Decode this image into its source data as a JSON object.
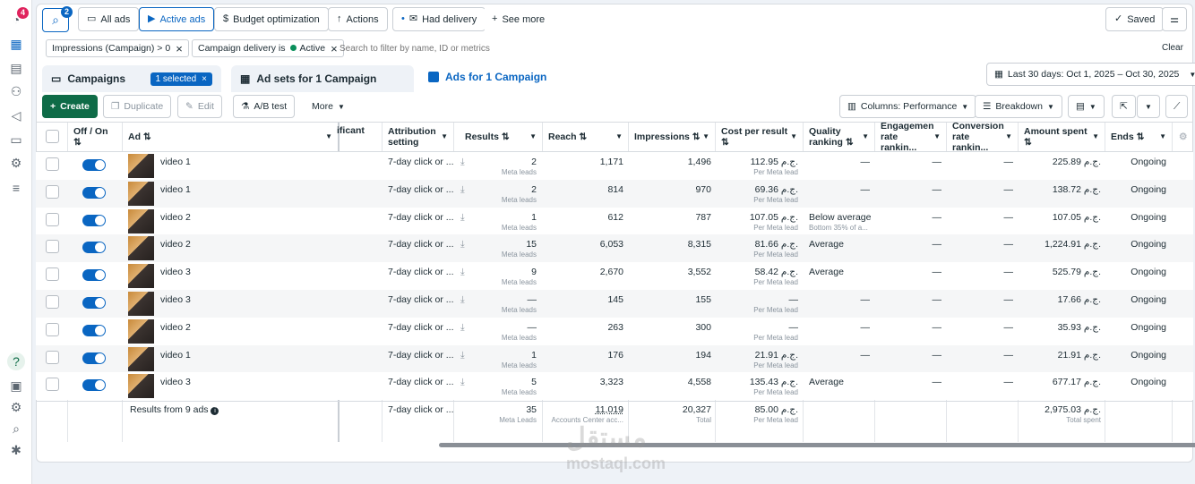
{
  "nav": {
    "notifications": "4",
    "search_badge": "2"
  },
  "filterbar": {
    "all_ads": "All ads",
    "active_ads": "Active ads",
    "budget_optimization": "Budget optimization",
    "actions": "Actions",
    "had_delivery": "Had delivery",
    "see_more": "See more",
    "saved": "Saved"
  },
  "filters": {
    "chip1": "Impressions (Campaign) > 0",
    "chip2_prefix": "Campaign delivery is",
    "chip2_value": "Active",
    "search_placeholder": "Search to filter by name, ID or metrics",
    "clear": "Clear"
  },
  "tabs": {
    "campaigns": "Campaigns",
    "selected": "1 selected",
    "adsets": "Ad sets for 1 Campaign",
    "ads": "Ads for 1 Campaign",
    "date_range": "Last 30 days: Oct 1, 2025 – Oct 30, 2025"
  },
  "toolbar": {
    "create": "Create",
    "duplicate": "Duplicate",
    "edit": "Edit",
    "ab_test": "A/B test",
    "more": "More",
    "columns": "Columns: Performance",
    "breakdown": "Breakdown"
  },
  "columns": {
    "onoff": "Off / On",
    "ad": "Ad",
    "significant": "ificant",
    "attribution": "Attribution setting",
    "results": "Results",
    "reach": "Reach",
    "impressions": "Impressions",
    "cpr": "Cost per result",
    "quality": "Quality ranking",
    "engagement": "Engagement rate rankin...",
    "conversion": "Conversion rate rankin...",
    "amount": "Amount spent",
    "ends": "Ends"
  },
  "rows": [
    {
      "ad": "video 1",
      "attr": "7-day click or ...",
      "results": "2",
      "results_sub": "Meta leads",
      "reach": "1,171",
      "impr": "1,496",
      "cpr": "112.95 ج.م.",
      "cpr_sub": "Per Meta lead",
      "quality": "—",
      "quality_sub": "",
      "eng": "—",
      "conv": "—",
      "amount": "225.89 ج.م.",
      "ends": "Ongoing"
    },
    {
      "ad": "video 1",
      "attr": "7-day click or ...",
      "results": "2",
      "results_sub": "Meta leads",
      "reach": "814",
      "impr": "970",
      "cpr": "69.36 ج.م.",
      "cpr_sub": "Per Meta lead",
      "quality": "—",
      "quality_sub": "",
      "eng": "—",
      "conv": "—",
      "amount": "138.72 ج.م.",
      "ends": "Ongoing"
    },
    {
      "ad": "video 2",
      "attr": "7-day click or ...",
      "results": "1",
      "results_sub": "Meta leads",
      "reach": "612",
      "impr": "787",
      "cpr": "107.05 ج.م.",
      "cpr_sub": "Per Meta lead",
      "quality": "Below average",
      "quality_sub": "Bottom 35% of a...",
      "eng": "—",
      "conv": "—",
      "amount": "107.05 ج.م.",
      "ends": "Ongoing"
    },
    {
      "ad": "video 2",
      "attr": "7-day click or ...",
      "results": "15",
      "results_sub": "Meta leads",
      "reach": "6,053",
      "impr": "8,315",
      "cpr": "81.66 ج.م.",
      "cpr_sub": "Per Meta lead",
      "quality": "Average",
      "quality_sub": "",
      "eng": "—",
      "conv": "—",
      "amount": "1,224.91 ج.م.",
      "ends": "Ongoing"
    },
    {
      "ad": "video 3",
      "attr": "7-day click or ...",
      "results": "9",
      "results_sub": "Meta leads",
      "reach": "2,670",
      "impr": "3,552",
      "cpr": "58.42 ج.م.",
      "cpr_sub": "Per Meta lead",
      "quality": "Average",
      "quality_sub": "",
      "eng": "—",
      "conv": "—",
      "amount": "525.79 ج.م.",
      "ends": "Ongoing"
    },
    {
      "ad": "video 3",
      "attr": "7-day click or ...",
      "results": "—",
      "results_sub": "Meta leads",
      "reach": "145",
      "impr": "155",
      "cpr": "—",
      "cpr_sub": "Per Meta lead",
      "quality": "—",
      "quality_sub": "",
      "eng": "—",
      "conv": "—",
      "amount": "17.66 ج.م.",
      "ends": "Ongoing"
    },
    {
      "ad": "video 2",
      "attr": "7-day click or ...",
      "results": "—",
      "results_sub": "Meta leads",
      "reach": "263",
      "impr": "300",
      "cpr": "—",
      "cpr_sub": "Per Meta lead",
      "quality": "—",
      "quality_sub": "",
      "eng": "—",
      "conv": "—",
      "amount": "35.93 ج.م.",
      "ends": "Ongoing"
    },
    {
      "ad": "video 1",
      "attr": "7-day click or ...",
      "results": "1",
      "results_sub": "Meta leads",
      "reach": "176",
      "impr": "194",
      "cpr": "21.91 ج.م.",
      "cpr_sub": "Per Meta lead",
      "quality": "—",
      "quality_sub": "",
      "eng": "—",
      "conv": "—",
      "amount": "21.91 ج.م.",
      "ends": "Ongoing"
    },
    {
      "ad": "video 3",
      "attr": "7-day click or ...",
      "results": "5",
      "results_sub": "Meta leads",
      "reach": "3,323",
      "impr": "4,558",
      "cpr": "135.43 ج.م.",
      "cpr_sub": "Per Meta lead",
      "quality": "Average",
      "quality_sub": "",
      "eng": "—",
      "conv": "—",
      "amount": "677.17 ج.م.",
      "ends": "Ongoing"
    }
  ],
  "totals": {
    "label": "Results from 9 ads",
    "attr": "7-day click or ...",
    "results": "35",
    "results_sub": "Meta Leads",
    "reach": "11,019",
    "reach_sub": "Accounts Center acc...",
    "impr": "20,327",
    "impr_sub": "Total",
    "cpr": "85.00 ج.م.",
    "cpr_sub": "Per Meta lead",
    "amount": "2,975.03 ج.م.",
    "amount_sub": "Total spent"
  },
  "watermark": {
    "ar": "مستقل",
    "en": "mostaql.com"
  }
}
